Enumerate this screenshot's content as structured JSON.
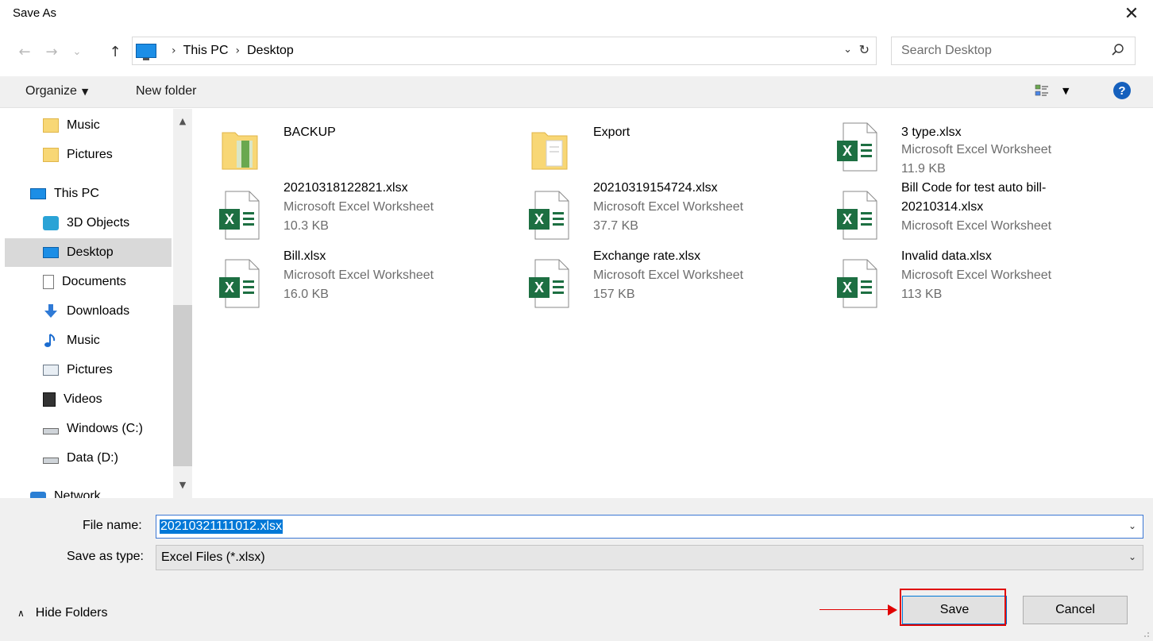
{
  "window": {
    "title": "Save As",
    "close_glyph": "✕"
  },
  "nav": {
    "back_glyph": "←",
    "forward_glyph": "→",
    "recent_glyph": "⌄",
    "up_glyph": "↑",
    "breadcrumb": [
      "This PC",
      "Desktop"
    ],
    "crumb_sep": "›",
    "dropdown_glyph": "⌄",
    "refresh_glyph": "↻",
    "search_placeholder": "Search Desktop"
  },
  "toolbar": {
    "organize_label": "Organize",
    "new_folder_label": "New folder",
    "help_label": "?"
  },
  "sidebar": {
    "items": [
      {
        "label": "Music",
        "icon": "folder-icon"
      },
      {
        "label": "Pictures",
        "icon": "folder-icon"
      },
      {
        "label": "This PC",
        "icon": "pc-icon"
      },
      {
        "label": "3D Objects",
        "icon": "3d-objects-icon"
      },
      {
        "label": "Desktop",
        "icon": "desktop-icon",
        "selected": true
      },
      {
        "label": "Documents",
        "icon": "documents-icon"
      },
      {
        "label": "Downloads",
        "icon": "downloads-icon"
      },
      {
        "label": "Music",
        "icon": "music-icon"
      },
      {
        "label": "Pictures",
        "icon": "pictures-icon"
      },
      {
        "label": "Videos",
        "icon": "videos-icon"
      },
      {
        "label": "Windows (C:)",
        "icon": "drive-c-icon"
      },
      {
        "label": "Data (D:)",
        "icon": "drive-d-icon"
      },
      {
        "label": "Network",
        "icon": "network-icon"
      }
    ]
  },
  "files": [
    {
      "name": "BACKUP",
      "type": "",
      "size": "",
      "kind": "folder"
    },
    {
      "name": "Export",
      "type": "",
      "size": "",
      "kind": "folder"
    },
    {
      "name": "3 type.xlsx",
      "type": "Microsoft Excel Worksheet",
      "size": "11.9 KB",
      "kind": "excel"
    },
    {
      "name": "20210318122821.xlsx",
      "type": "Microsoft Excel Worksheet",
      "size": "10.3 KB",
      "kind": "excel"
    },
    {
      "name": "20210319154724.xlsx",
      "type": "Microsoft Excel Worksheet",
      "size": "37.7 KB",
      "kind": "excel"
    },
    {
      "name": "Bill Code for test auto bill-20210314.xlsx",
      "type": "Microsoft Excel Worksheet",
      "size": "",
      "kind": "excel"
    },
    {
      "name": "Bill.xlsx",
      "type": "Microsoft Excel Worksheet",
      "size": "16.0 KB",
      "kind": "excel"
    },
    {
      "name": "Exchange rate.xlsx",
      "type": "Microsoft Excel Worksheet",
      "size": "157 KB",
      "kind": "excel"
    },
    {
      "name": "Invalid data.xlsx",
      "type": "Microsoft Excel Worksheet",
      "size": "113 KB",
      "kind": "excel"
    }
  ],
  "form": {
    "file_name_label": "File name:",
    "file_name_value": "20210321111012.xlsx",
    "save_type_label": "Save as type:",
    "save_type_value": "Excel Files (*.xlsx)",
    "hide_folders_label": "Hide Folders",
    "save_label": "Save",
    "cancel_label": "Cancel"
  },
  "colors": {
    "accent": "#0078d7",
    "highlight_red": "#e00000",
    "excel_green": "#1d6f42",
    "folder_yellow": "#f8d775"
  }
}
